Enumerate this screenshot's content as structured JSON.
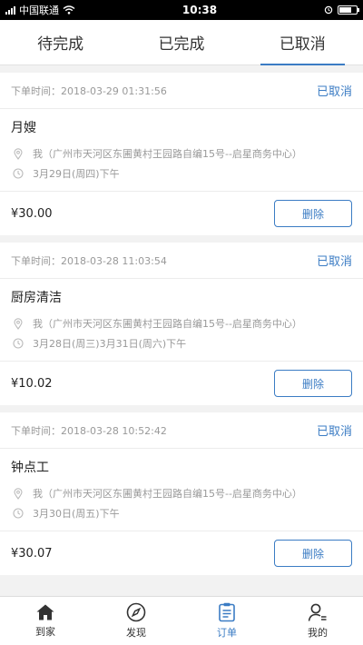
{
  "status_bar": {
    "carrier": "中国联通",
    "time": "10:38",
    "wifi_icon": "wifi-icon",
    "battery_level": 0.7
  },
  "tabs": [
    {
      "label": "待完成",
      "active": false
    },
    {
      "label": "已完成",
      "active": false
    },
    {
      "label": "已取消",
      "active": true
    }
  ],
  "orders": [
    {
      "time": "下单时间：2018-03-29 01:31:56",
      "status": "已取消",
      "service": "月嫂",
      "address": "我（广州市天河区东圃黄村王园路自编15号--启星商务中心）",
      "date": "3月29日(周四)下午",
      "price": "¥30.00",
      "delete_label": "删除"
    },
    {
      "time": "下单时间：2018-03-28 11:03:54",
      "status": "已取消",
      "service": "厨房清洁",
      "address": "我（广州市天河区东圃黄村王园路自编15号--启星商务中心）",
      "date": "3月28日(周三)3月31日(周六)下午",
      "price": "¥10.02",
      "delete_label": "删除"
    },
    {
      "time": "下单时间：2018-03-28 10:52:42",
      "status": "已取消",
      "service": "钟点工",
      "address": "我（广州市天河区东圃黄村王园路自编15号--启星商务中心）",
      "date": "3月30日(周五)下午",
      "price": "¥30.07",
      "delete_label": "删除"
    }
  ],
  "bottom_nav": [
    {
      "label": "到家",
      "icon": "home-icon",
      "active": false
    },
    {
      "label": "发现",
      "icon": "compass-icon",
      "active": false
    },
    {
      "label": "订单",
      "icon": "order-list-icon",
      "active": true
    },
    {
      "label": "我的",
      "icon": "user-icon",
      "active": false
    }
  ],
  "colors": {
    "accent": "#3b7cc4",
    "muted_text": "#999999",
    "page_bg": "#f2f2f2"
  }
}
